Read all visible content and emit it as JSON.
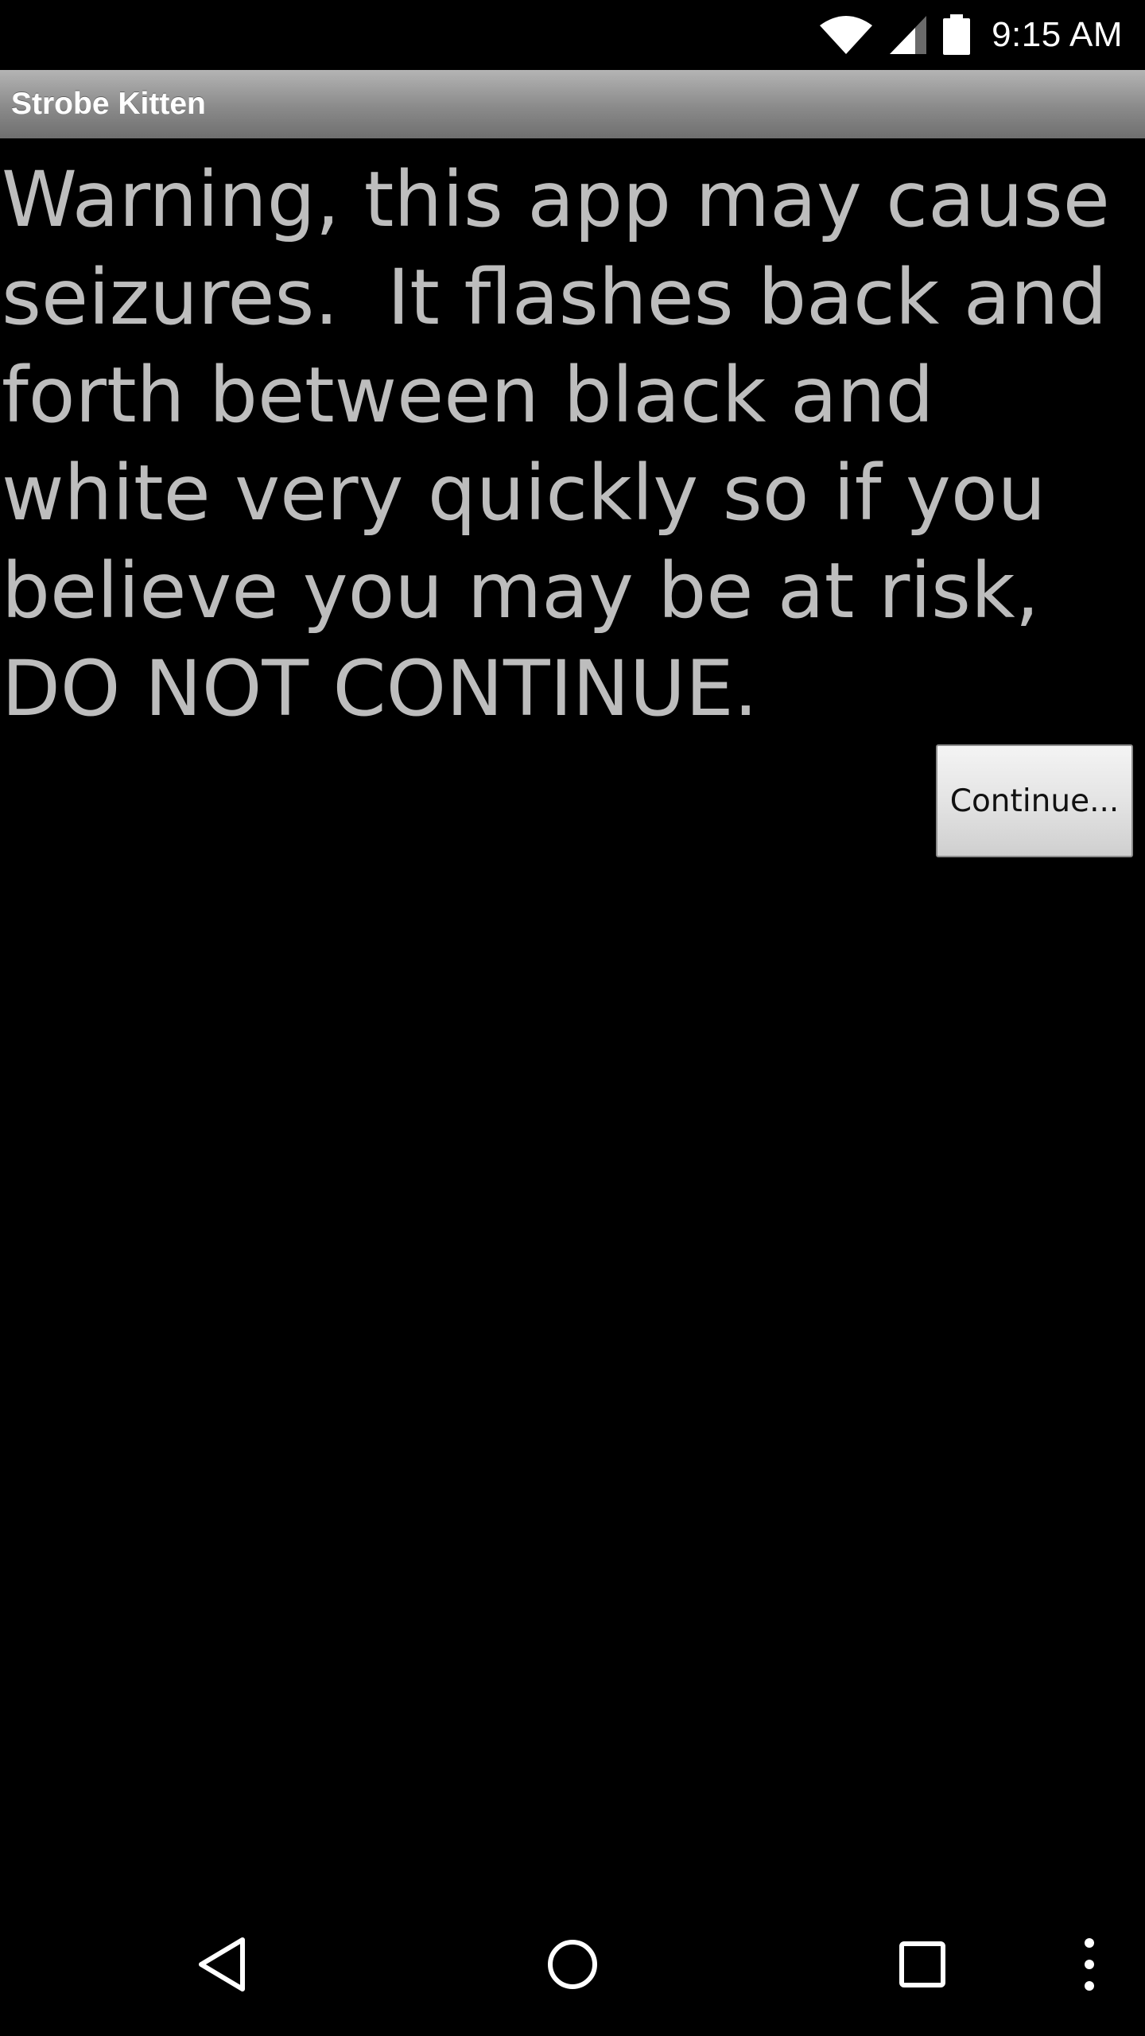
{
  "status_bar": {
    "time": "9:15 AM",
    "icons": [
      "wifi-icon",
      "cell-signal-icon",
      "battery-icon"
    ]
  },
  "app": {
    "title": "Strobe Kitten"
  },
  "main": {
    "warning_text": "Warning, this app may cause seizures.  It flashes back and forth between black and white very quickly so if you believe you may be at risk, DO NOT CONTINUE.",
    "continue_label": "Continue..."
  },
  "nav_bar": {
    "icons": [
      "back-icon",
      "home-icon",
      "recents-icon",
      "overflow-menu-icon"
    ]
  },
  "colors": {
    "background": "#000000",
    "title_bar_gradient_top": "#b4b4b4",
    "title_bar_gradient_bottom": "#6f6f6f",
    "warning_text": "#bdbdbd",
    "button_face": "#e4e4e4"
  }
}
